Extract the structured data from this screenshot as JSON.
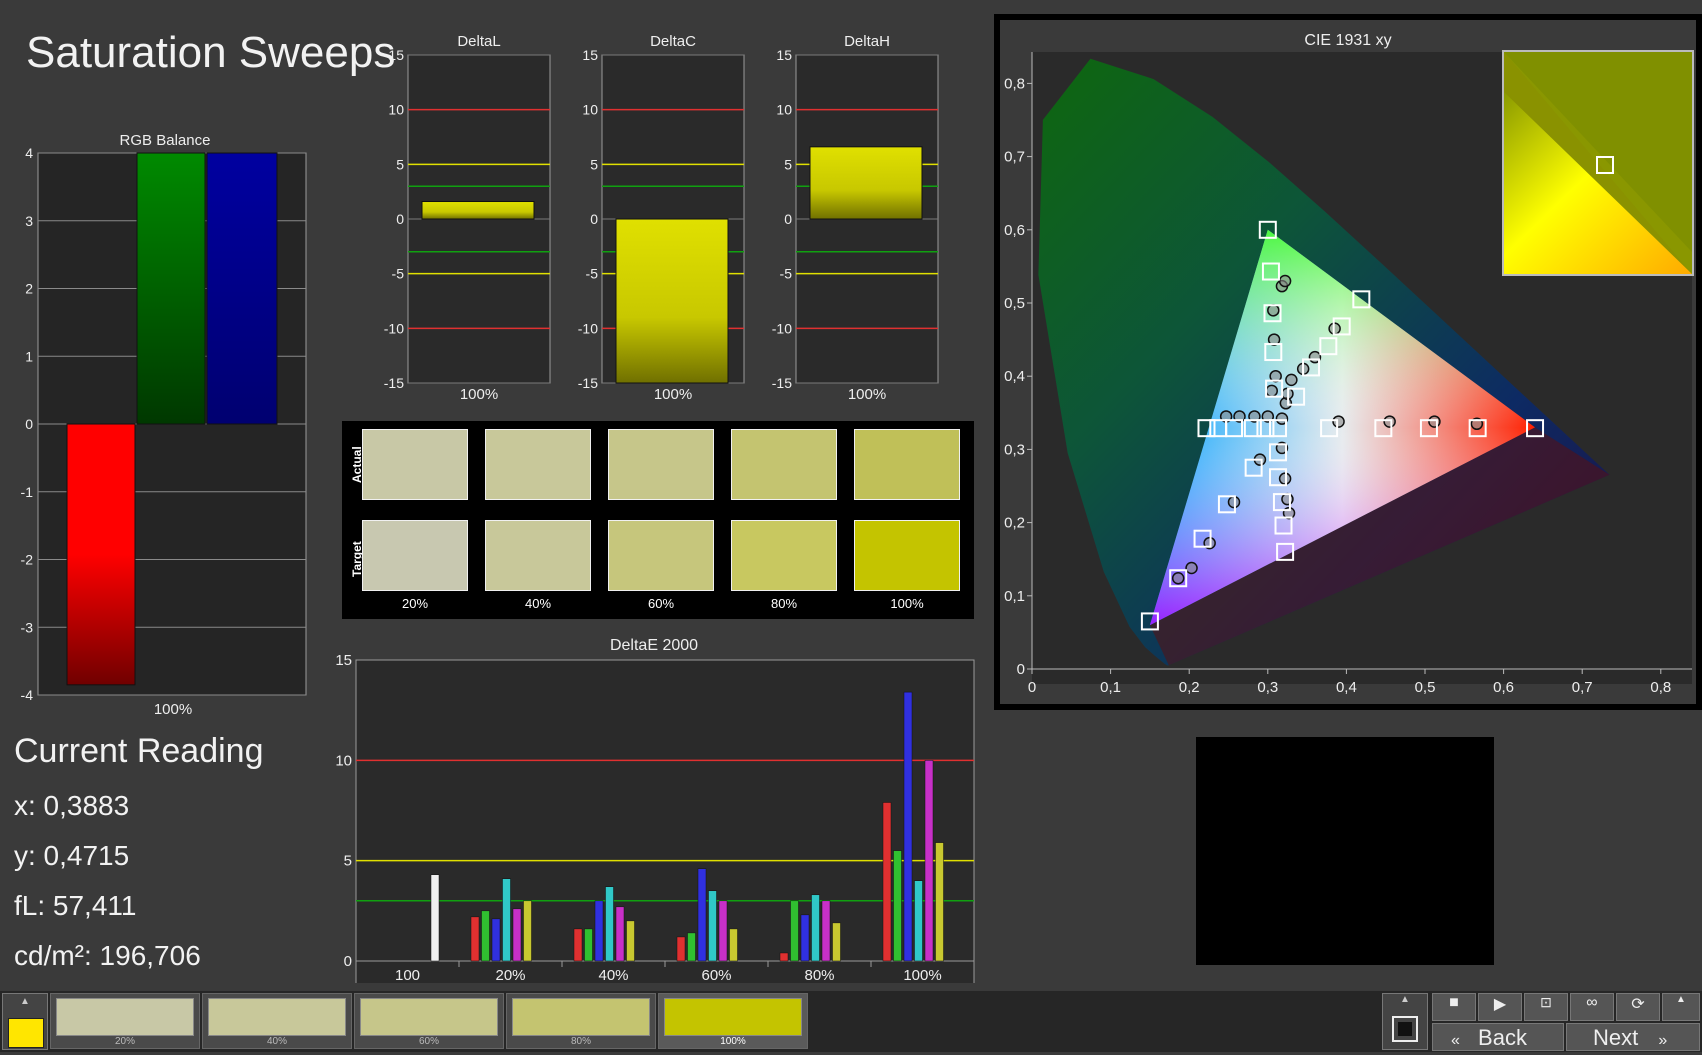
{
  "title": "Saturation Sweeps",
  "rgb_balance": {
    "title": "RGB Balance",
    "x_label": "100%",
    "yticks": [
      "4",
      "3",
      "2",
      "1",
      "0",
      "-1",
      "-2",
      "-3",
      "-4"
    ],
    "values": {
      "red": -3.85,
      "green": 4.0,
      "blue": 4.0
    },
    "ylim": [
      -4,
      4
    ]
  },
  "delta_charts": [
    {
      "title": "DeltaL",
      "x_label": "100%",
      "value": 1.6,
      "yticks": [
        "15",
        "10",
        "5",
        "0",
        "-5",
        "-10",
        "-15"
      ]
    },
    {
      "title": "DeltaC",
      "x_label": "100%",
      "value": -15,
      "yticks": [
        "15",
        "10",
        "5",
        "0",
        "-5",
        "-10",
        "-15"
      ]
    },
    {
      "title": "DeltaH",
      "x_label": "100%",
      "value": 6.6,
      "yticks": [
        "15",
        "10",
        "5",
        "0",
        "-5",
        "-10",
        "-15"
      ]
    }
  ],
  "swatches": {
    "row_labels": [
      "Actual",
      "Target"
    ],
    "levels": [
      "20%",
      "40%",
      "60%",
      "80%",
      "100%"
    ],
    "actual_colors": [
      "#c8c8a6",
      "#c8c89a",
      "#c6c68a",
      "#c4c470",
      "#c0c058"
    ],
    "target_colors": [
      "#c8c8b0",
      "#c8c89a",
      "#c6c67c",
      "#c8c860",
      "#c4c400"
    ]
  },
  "chart_data": {
    "type": "bar",
    "title": "DeltaE 2000",
    "categories": [
      "100",
      "20%",
      "40%",
      "60%",
      "80%",
      "100%"
    ],
    "yticks": [
      "15",
      "10",
      "5",
      "0"
    ],
    "ylim": [
      0,
      15
    ],
    "series": [
      {
        "color": "#e03030",
        "values": [
          null,
          2.2,
          1.6,
          1.2,
          0.4,
          7.9
        ]
      },
      {
        "color": "#30c030",
        "values": [
          null,
          2.5,
          1.6,
          1.4,
          3.0,
          5.5
        ]
      },
      {
        "color": "#3030e0",
        "values": [
          null,
          2.1,
          3.0,
          4.6,
          2.3,
          13.4
        ]
      },
      {
        "color": "#30c8c8",
        "values": [
          null,
          4.1,
          3.7,
          3.5,
          3.3,
          4.0
        ]
      },
      {
        "color": "#c830c8",
        "values": [
          null,
          2.6,
          2.7,
          3.0,
          3.0,
          10.0
        ]
      },
      {
        "color": "#c8c830",
        "values": [
          null,
          3.0,
          2.0,
          1.6,
          1.9,
          5.9
        ]
      },
      {
        "color": "#f0f0f0",
        "values": [
          4.3,
          null,
          null,
          null,
          null,
          null
        ]
      }
    ]
  },
  "cie": {
    "title": "CIE 1931 xy",
    "xticks": [
      "0",
      "0,1",
      "0,2",
      "0,3",
      "0,4",
      "0,5",
      "0,6",
      "0,7",
      "0,8"
    ],
    "yticks": [
      "0",
      "0,1",
      "0,2",
      "0,3",
      "0,4",
      "0,5",
      "0,6",
      "0,7",
      "0,8"
    ],
    "gamut": [
      [
        0.64,
        0.33
      ],
      [
        0.3,
        0.6
      ],
      [
        0.15,
        0.06
      ]
    ],
    "targets": [
      [
        0.313,
        0.329
      ],
      [
        0.336,
        0.372
      ],
      [
        0.355,
        0.412
      ],
      [
        0.377,
        0.441
      ],
      [
        0.394,
        0.468
      ],
      [
        0.419,
        0.505
      ],
      [
        0.308,
        0.383
      ],
      [
        0.307,
        0.433
      ],
      [
        0.306,
        0.486
      ],
      [
        0.304,
        0.543
      ],
      [
        0.3,
        0.6
      ],
      [
        0.313,
        0.296
      ],
      [
        0.313,
        0.262
      ],
      [
        0.318,
        0.228
      ],
      [
        0.32,
        0.196
      ],
      [
        0.322,
        0.16
      ],
      [
        0.237,
        0.329
      ],
      [
        0.257,
        0.329
      ],
      [
        0.281,
        0.329
      ],
      [
        0.297,
        0.329
      ],
      [
        0.222,
        0.329
      ],
      [
        0.378,
        0.329
      ],
      [
        0.447,
        0.329
      ],
      [
        0.505,
        0.329
      ],
      [
        0.567,
        0.329
      ],
      [
        0.64,
        0.329
      ],
      [
        0.282,
        0.275
      ],
      [
        0.248,
        0.225
      ],
      [
        0.217,
        0.178
      ],
      [
        0.186,
        0.124
      ],
      [
        0.15,
        0.065
      ]
    ],
    "measured": [
      [
        0.323,
        0.363
      ],
      [
        0.325,
        0.376
      ],
      [
        0.33,
        0.395
      ],
      [
        0.345,
        0.41
      ],
      [
        0.36,
        0.426
      ],
      [
        0.385,
        0.465
      ],
      [
        0.305,
        0.38
      ],
      [
        0.31,
        0.4
      ],
      [
        0.308,
        0.45
      ],
      [
        0.307,
        0.49
      ],
      [
        0.318,
        0.523
      ],
      [
        0.322,
        0.53
      ],
      [
        0.318,
        0.302
      ],
      [
        0.322,
        0.26
      ],
      [
        0.325,
        0.232
      ],
      [
        0.327,
        0.213
      ],
      [
        0.247,
        0.345
      ],
      [
        0.264,
        0.345
      ],
      [
        0.283,
        0.345
      ],
      [
        0.3,
        0.345
      ],
      [
        0.318,
        0.342
      ],
      [
        0.39,
        0.338
      ],
      [
        0.455,
        0.338
      ],
      [
        0.512,
        0.338
      ],
      [
        0.566,
        0.335
      ],
      [
        0.29,
        0.286
      ],
      [
        0.257,
        0.228
      ],
      [
        0.226,
        0.172
      ],
      [
        0.203,
        0.138
      ],
      [
        0.186,
        0.124
      ]
    ]
  },
  "current_reading": {
    "title": "Current Reading",
    "x": "x: 0,3883",
    "y": "y: 0,4715",
    "fl": "fL: 57,411",
    "cdm2": "cd/m²: 196,706"
  },
  "bottom": {
    "current_color": "#ffe600",
    "tabs": [
      {
        "label": "20%",
        "color": "#c8c8a6"
      },
      {
        "label": "40%",
        "color": "#c8c89a"
      },
      {
        "label": "60%",
        "color": "#c6c68a"
      },
      {
        "label": "80%",
        "color": "#c4c470"
      },
      {
        "label": "100%",
        "color": "#c4c400"
      }
    ],
    "back_label": "Back",
    "next_label": "Next"
  }
}
